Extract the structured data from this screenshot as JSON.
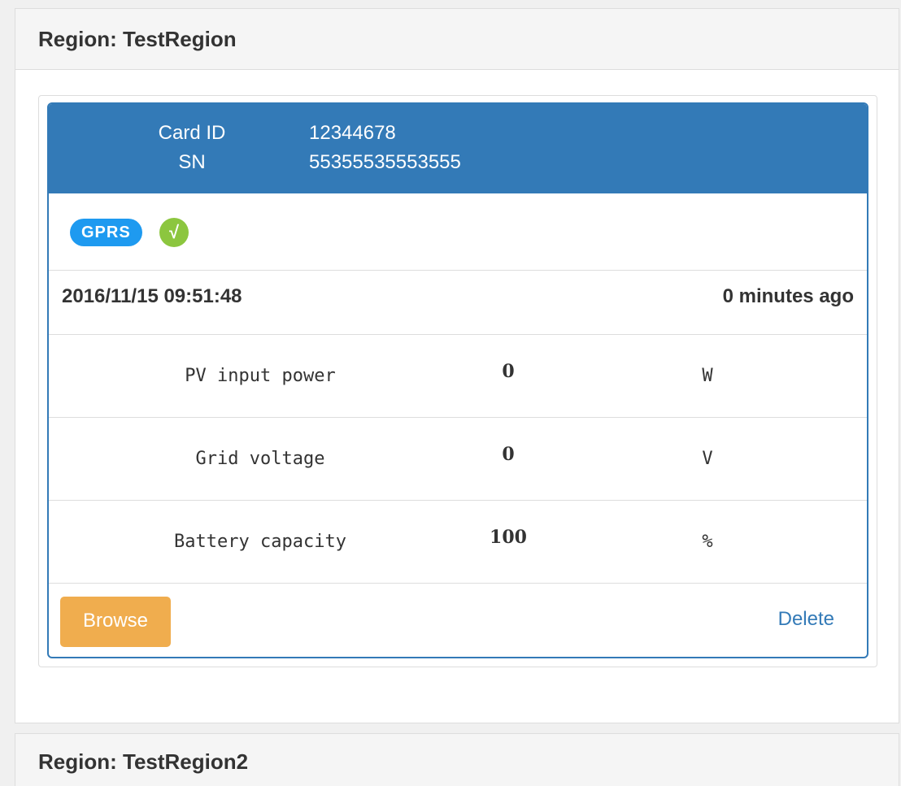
{
  "regions": [
    {
      "title": "Region: TestRegion",
      "device": {
        "card_id_label": "Card ID",
        "card_id_value": "12344678",
        "sn_label": "SN",
        "sn_value": "55355535553555",
        "connection_badge": "GPRS",
        "status_check": "√",
        "timestamp": "2016/11/15 09:51:48",
        "relative_time": "0 minutes ago",
        "metrics": [
          {
            "name": "PV input power",
            "value": "0",
            "unit": "W"
          },
          {
            "name": "Grid voltage",
            "value": "0",
            "unit": "V"
          },
          {
            "name": "Battery capacity",
            "value": "100",
            "unit": "%"
          }
        ],
        "browse_label": "Browse",
        "delete_label": "Delete"
      }
    },
    {
      "title": "Region: TestRegion2"
    }
  ],
  "colors": {
    "header_blue": "#337ab7",
    "badge_blue": "#1e9af0",
    "check_green": "#8cc63f",
    "browse_orange": "#f0ad4e"
  }
}
